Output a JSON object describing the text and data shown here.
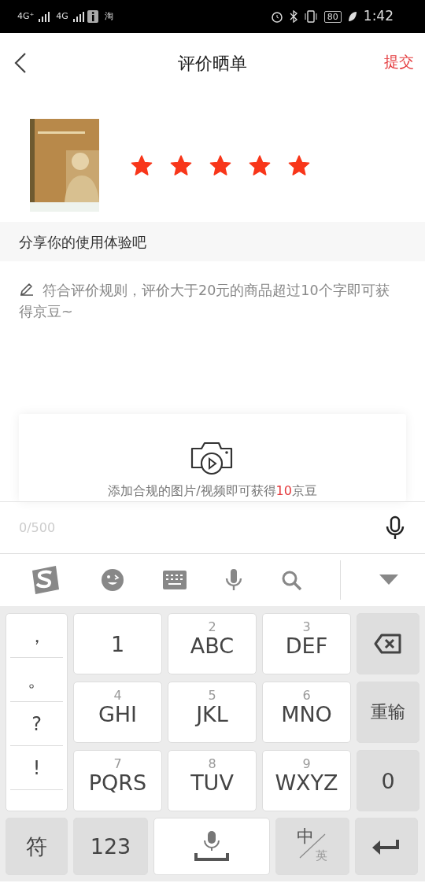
{
  "status_bar": {
    "network_1": "4G⁺",
    "network_2": "4G",
    "notification": "淘",
    "battery": "80",
    "time": "1:42"
  },
  "header": {
    "title": "评价晒单",
    "action": "提交"
  },
  "product": {
    "stars": 5
  },
  "prompt": "分享你的使用体验吧",
  "hint": "符合评价规则，评价大于20元的商品超过10个字即可获得京豆~",
  "upload": {
    "text": "添加合规的图片/视频即可获得**10**京豆"
  },
  "input_bar": {
    "counter": "0/500"
  },
  "keyboard": {
    "symbols": [
      "，",
      "。",
      "?",
      "!"
    ],
    "key_rows": [
      [
        {
          "letters": "1"
        },
        {
          "digit": "2",
          "letters": "ABC"
        },
        {
          "digit": "3",
          "letters": "DEF"
        }
      ],
      [
        {
          "digit": "4",
          "letters": "GHI"
        },
        {
          "digit": "5",
          "letters": "JKL"
        },
        {
          "digit": "6",
          "letters": "MNO"
        }
      ],
      [
        {
          "digit": "7",
          "letters": "PQRS"
        },
        {
          "digit": "8",
          "letters": "TUV"
        },
        {
          "digit": "9",
          "letters": "WXYZ"
        }
      ]
    ],
    "side_keys": [
      "重输",
      "0"
    ],
    "bottom": {
      "symbols_key": "符",
      "numbers_key": "123",
      "lang_main": "中",
      "lang_alt": "英"
    }
  }
}
